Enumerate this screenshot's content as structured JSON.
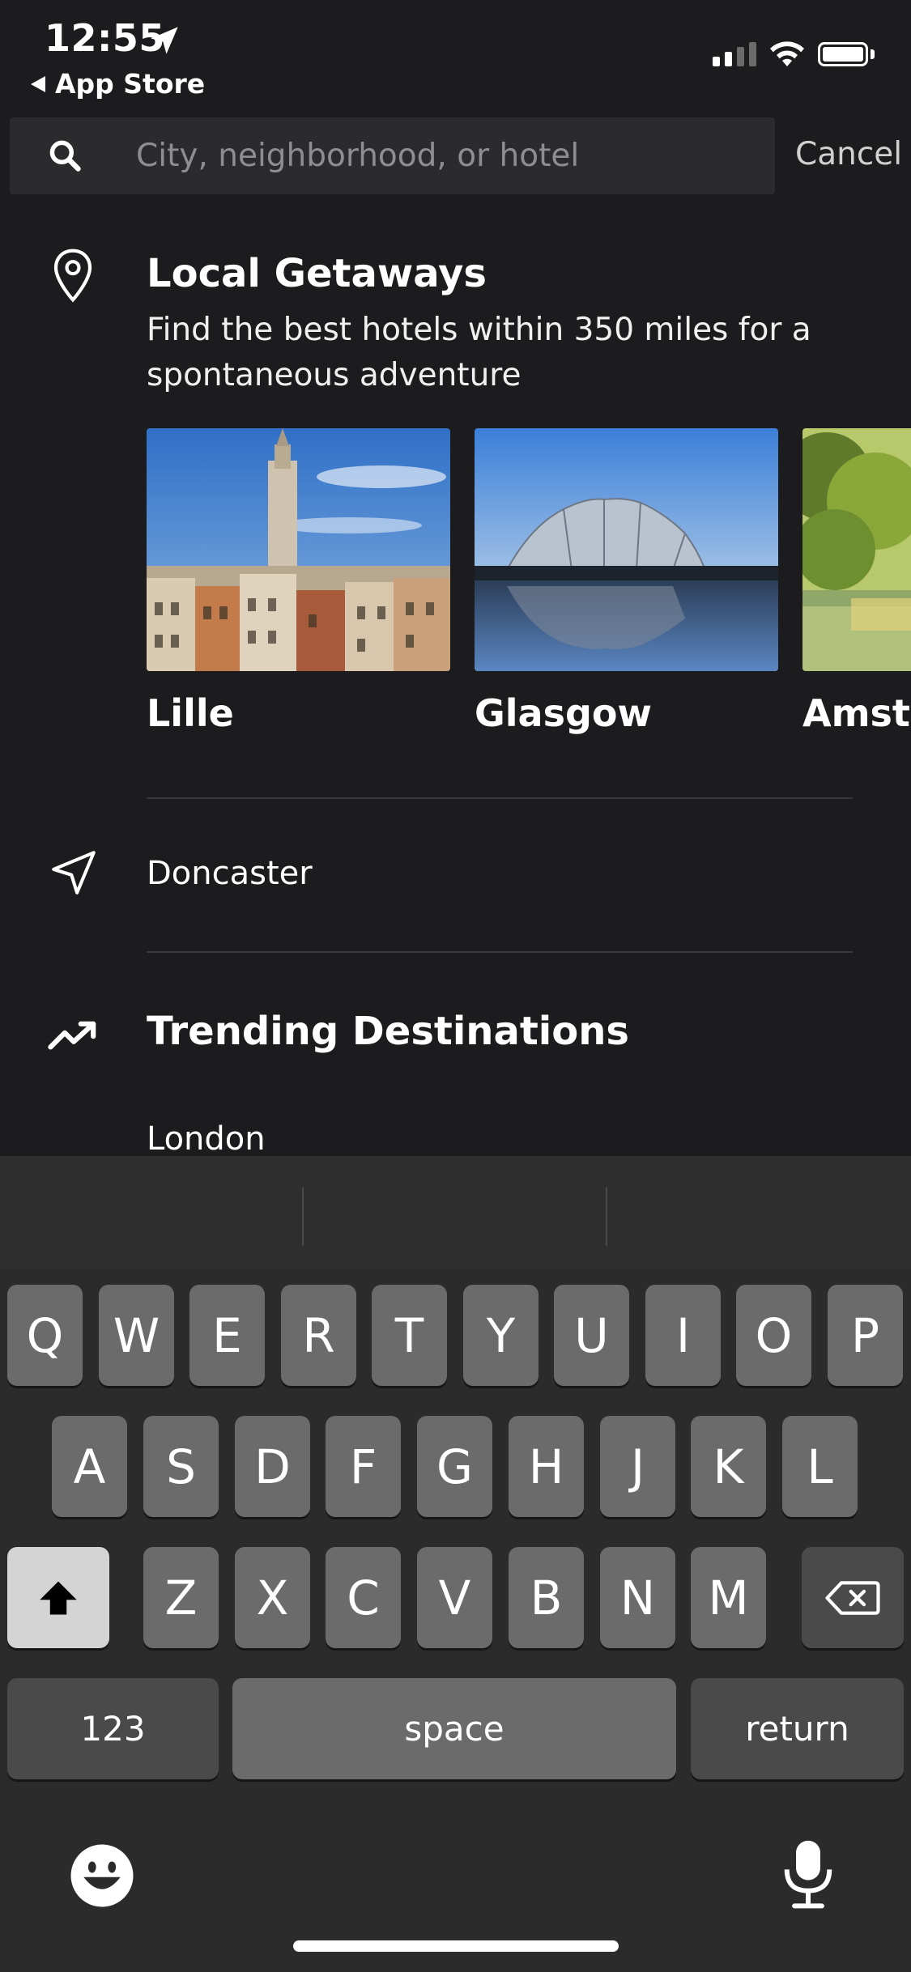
{
  "status_bar": {
    "time": "12:55",
    "back_label": "App Store"
  },
  "search": {
    "placeholder": "City, neighborhood, or hotel",
    "value": "",
    "cancel_label": "Cancel"
  },
  "local_getaways": {
    "title": "Local Getaways",
    "description": "Find the best hotels within 350 miles for a spontaneous adventure",
    "cities": [
      {
        "name": "Lille"
      },
      {
        "name": "Glasgow"
      },
      {
        "name": "Amste"
      }
    ]
  },
  "current_location": {
    "label": "Doncaster"
  },
  "trending": {
    "title": "Trending Destinations",
    "items": [
      "London"
    ]
  },
  "keyboard": {
    "row1": [
      "Q",
      "W",
      "E",
      "R",
      "T",
      "Y",
      "U",
      "I",
      "O",
      "P"
    ],
    "row2": [
      "A",
      "S",
      "D",
      "F",
      "G",
      "H",
      "J",
      "K",
      "L"
    ],
    "row3": [
      "Z",
      "X",
      "C",
      "V",
      "B",
      "N",
      "M"
    ],
    "numbers_label": "123",
    "space_label": "space",
    "return_label": "return"
  },
  "icons": {
    "location_arrow": "location-arrow-icon",
    "search": "search-icon",
    "pin": "map-pin-icon",
    "nav": "navigation-arrow-icon",
    "trend": "trending-up-icon",
    "shift": "shift-icon",
    "backspace": "backspace-icon",
    "emoji": "emoji-icon",
    "mic": "microphone-icon"
  }
}
